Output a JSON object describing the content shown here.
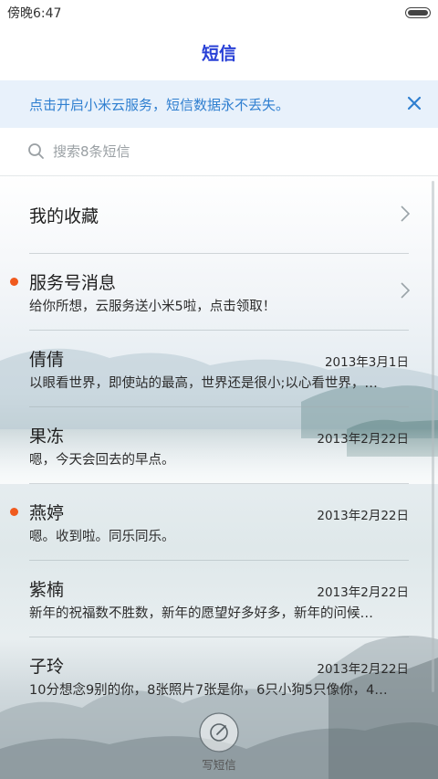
{
  "status_bar": {
    "time": "傍晚6:47"
  },
  "header": {
    "title": "短信"
  },
  "banner": {
    "text": "点击开启小米云服务，短信数据永不丢失。",
    "close_icon": "close-icon"
  },
  "search": {
    "placeholder": "搜索8条短信"
  },
  "conversations": [
    {
      "name": "我的收藏",
      "preview": "",
      "date": "",
      "unread": false,
      "chevron": true
    },
    {
      "name": "服务号消息",
      "preview": "给你所想，云服务送小米5啦，点击领取！",
      "date": "",
      "unread": true,
      "chevron": true
    },
    {
      "name": "倩倩",
      "preview": "以眼看世界，即使站的最高，世界还是很小;以心看世界，…",
      "date": "2013年3月1日",
      "unread": false,
      "chevron": false
    },
    {
      "name": "果冻",
      "preview": "嗯，今天会回去的早点。",
      "date": "2013年2月22日",
      "unread": false,
      "chevron": false
    },
    {
      "name": "燕婷",
      "preview": "嗯。收到啦。同乐同乐。",
      "date": "2013年2月22日",
      "unread": true,
      "chevron": false
    },
    {
      "name": "紫楠",
      "preview": "新年的祝福数不胜数，新年的愿望好多好多，新年的问候…",
      "date": "2013年2月22日",
      "unread": false,
      "chevron": false
    },
    {
      "name": "子玲",
      "preview": "10分想念9别的你，8张照片7张是你，6只小狗5只像你，4…",
      "date": "2013年2月22日",
      "unread": false,
      "chevron": false
    }
  ],
  "compose": {
    "label": "写短信"
  },
  "colors": {
    "accent": "#2840d6",
    "banner_text": "#2f7fd0",
    "unread_dot": "#f05a1e"
  }
}
